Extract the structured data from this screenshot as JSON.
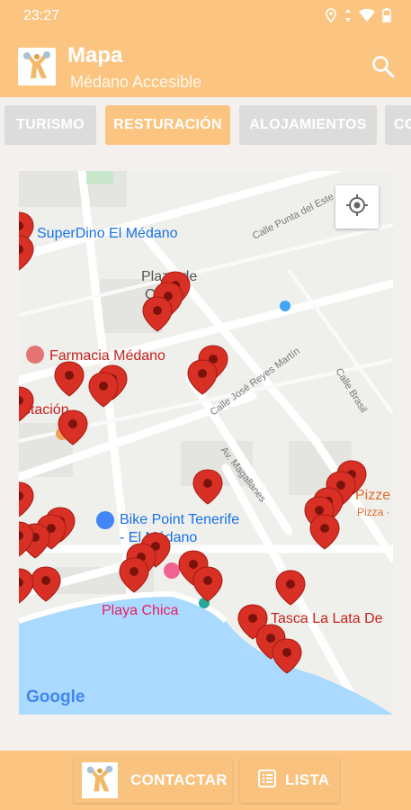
{
  "status": {
    "time": "23:27"
  },
  "appbar": {
    "title": "Mapa",
    "subtitle": "Médano Accesible",
    "search_icon": "search-icon"
  },
  "tabs": [
    {
      "label": "TURISMO",
      "active": false
    },
    {
      "label": "RESTURACIÓN",
      "active": true
    },
    {
      "label": "ALOJAMIENTOS",
      "active": false
    },
    {
      "label": "CO",
      "active": false
    }
  ],
  "map": {
    "labels": {
      "superdino": "SuperDino El Médano",
      "plaza1": "Plaza de",
      "plaza2": "Chica",
      "farmacia": "Farmacia Médano",
      "estacion": "estación",
      "bike1": "Bike Point Tenerife",
      "bike2": "- El Médano",
      "playa": "Playa Chica",
      "tasca": "Tasca La Lata De",
      "pizze": "Pizze",
      "pizza": "Pizza ·",
      "calle_punta": "Calle Punta del Este",
      "calle_jose": "Calle José Reyes Martín",
      "calle_brasil": "Calle Brasil",
      "av_magallanes": "Av. Magallanes",
      "google": "Google"
    },
    "accent_color": "#d93025"
  },
  "bottom": {
    "contact_label": "CONTACTAR",
    "list_label": "LISTA"
  },
  "colors": {
    "primary": "#fbc581",
    "inactive_tab": "#dcdcdc",
    "marker": "#d93025",
    "water": "#aadaff"
  }
}
